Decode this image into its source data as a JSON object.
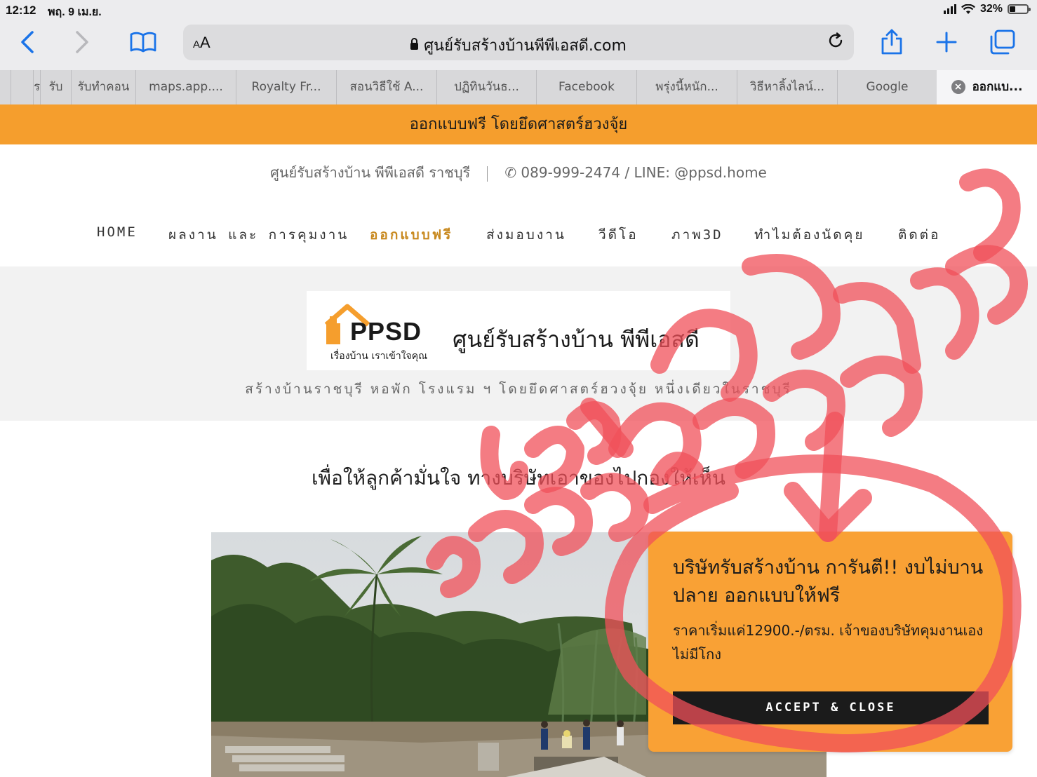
{
  "status_bar": {
    "time": "12:12",
    "date": "พฤ. 9 เม.ย.",
    "battery": "32%",
    "battery_level": 0.32
  },
  "toolbar": {
    "aa_label": "AA",
    "url": "ศูนย์รับสร้างบ้านพีพีเอสดี.com",
    "icons": [
      "back-icon",
      "forward-icon",
      "bookmarks-icon",
      "lock-icon",
      "reload-icon",
      "share-icon",
      "new-tab-icon",
      "tabs-overview-icon"
    ]
  },
  "tabs": [
    {
      "label": ""
    },
    {
      "label": "ร"
    },
    {
      "label": "รับ"
    },
    {
      "label": "รับทำคอน"
    },
    {
      "label": "maps.app...."
    },
    {
      "label": "Royalty Fr..."
    },
    {
      "label": "สอนวิธีใช้ A..."
    },
    {
      "label": "ปฏิทินวันธ..."
    },
    {
      "label": "Facebook"
    },
    {
      "label": "พรุ่งนี้หนัก..."
    },
    {
      "label": "วิธีหาลิ้งไลน์..."
    },
    {
      "label": "Google"
    },
    {
      "label": "ออกแบ..."
    }
  ],
  "banner": {
    "text": "ออกแบบฟรี โดยยึดศาสตร์ฮวงจุ้ย"
  },
  "site_info": {
    "name": "ศูนย์รับสร้างบ้าน พีพีเอสดี ราชบุรี",
    "contact": "✆ 089-999-2474 / LINE: @ppsd.home"
  },
  "nav": [
    {
      "label": "HOME"
    },
    {
      "label": "ผลงาน และ การคุมงาน"
    },
    {
      "label": "ออกแบบฟรี"
    },
    {
      "label": "ส่งมอบงาน"
    },
    {
      "label": "วีดีโอ"
    },
    {
      "label": "ภาพ3D"
    },
    {
      "label": "ทำไมต้องนัดคุย"
    },
    {
      "label": "ติดต่อ"
    }
  ],
  "hero": {
    "logo_text": "PPSD",
    "logo_tagline": "เรื่องบ้าน เราเข้าใจคุณ",
    "logo_name": "ศูนย์รับสร้างบ้าน พีพีเอสดี",
    "tagline": "สร้างบ้านราชบุรี หอพัก โรงแรม ฯ โดยยึดศาสตร์ฮวงจุ้ย หนึ่งเดียวในราชบุรี"
  },
  "headline": "เพื่อให้ลูกค้ามั่นใจ ทางบริษัทเอาของไปกองให้เห็น",
  "popup": {
    "title": "บริษัทรับสร้างบ้าน การันตี!! งบไม่บานปลาย ออกแบบให้ฟรี",
    "body": "ราคาเริ่มแค่12900.-/ตรม. เจ้าของบริษัทคุมงานเอง ไม่มีโกง",
    "button": "ACCEPT & CLOSE"
  },
  "colors": {
    "accent_orange": "#f59e2d",
    "popup_orange": "#f9a135",
    "nav_active": "#c8891f",
    "ios_blue": "#1a73e8",
    "scribble_red": "#f0505a"
  }
}
